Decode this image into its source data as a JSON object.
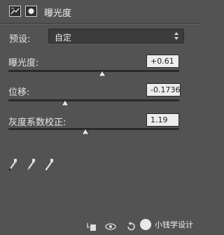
{
  "panel": {
    "title": "曝光度",
    "icons": [
      "adjustment-layer-icon",
      "layer-mask-icon"
    ]
  },
  "preset": {
    "label": "预设:",
    "value": "自定"
  },
  "params": [
    {
      "label": "曝光度:",
      "value": "+0.61",
      "slider_fraction": 0.55
    },
    {
      "label": "位移:",
      "value": "-0.1736",
      "slider_fraction": 0.33
    },
    {
      "label": "灰度系数校正:",
      "value": "1.19",
      "slider_fraction": 0.45
    }
  ],
  "eyedroppers": [
    "black-point-eyedropper-icon",
    "gray-point-eyedropper-icon",
    "white-point-eyedropper-icon"
  ],
  "bottom_icons": [
    "clip-to-layer-icon",
    "view-previous-state-icon",
    "reset-icon",
    "toggle-visibility-icon",
    "delete-icon"
  ],
  "watermark": {
    "text": "小钱学设计"
  },
  "colors": {
    "panel_bg": "#535353",
    "field_bg": "#ececec",
    "track": "#2a2a2a"
  }
}
